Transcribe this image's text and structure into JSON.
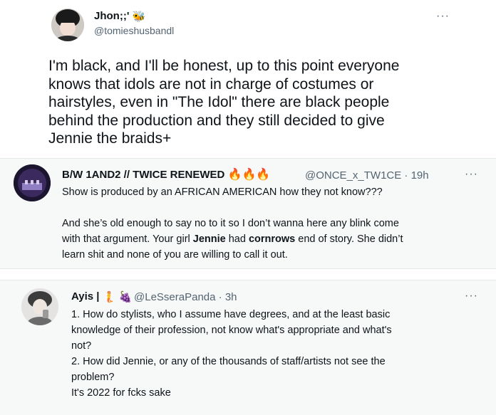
{
  "tweet1": {
    "display_name": "Jhon;;'",
    "name_emoji": "🐝",
    "handle": "@tomieshusbandl",
    "more": "···",
    "lines": [
      "I'm black, and I'll be honest, up to this point everyone",
      "knows that idols are not in charge of costumes or",
      "hairstyles, even in \"The Idol\" there are black people",
      "behind the production and they still decided to give",
      "Jennie the braids+"
    ]
  },
  "tweet2": {
    "display_name": "B/W 1AND2 // TWICE RENEWED",
    "name_emojis": [
      "🔥",
      "🔥",
      "🔥"
    ],
    "handle": "@ONCE_x_TW1CE",
    "separator": "·",
    "time": "19h",
    "more": "···",
    "line1": "Show is produced by an AFRICAN AMERICAN how they not know???",
    "line2": "And she’s old enough to say no to it so I don’t wanna here any blink come",
    "line3_a": "with that argument. Your girl ",
    "line3_b": "Jennie",
    "line3_c": " had ",
    "line3_d": "cornrows",
    "line3_e": " end of story. She didn’t",
    "line4": "learn shit and none of you are willing to call it out."
  },
  "tweet3": {
    "display_name": "Ayis |",
    "name_emojis": [
      "🧜",
      "🍇"
    ],
    "handle": "@LeSseraPanda",
    "separator": "·",
    "time": "3h",
    "more": "···",
    "lines": [
      "1. How do stylists, who I assume have degrees, and at the least basic",
      "knowledge of their profession, not know what's appropriate and what's",
      "not?",
      "2. How did Jennie, or any of the thousands of staff/artists not see the",
      "problem?",
      "It's 2022 for fcks sake"
    ]
  }
}
